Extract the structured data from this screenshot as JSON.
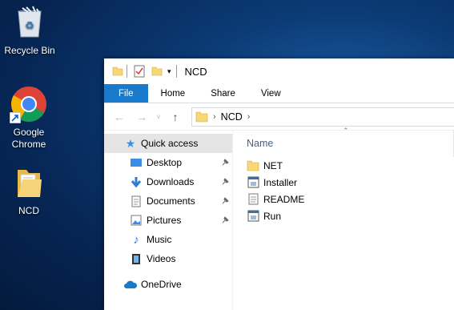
{
  "desktop": {
    "icons": [
      {
        "label": "Recycle Bin"
      },
      {
        "label": "Google Chrome"
      },
      {
        "label": "NCD"
      }
    ]
  },
  "window": {
    "title": "NCD",
    "ribbon_tabs": [
      "File",
      "Home",
      "Share",
      "View"
    ],
    "active_tab": "File",
    "address": {
      "path": [
        "NCD"
      ]
    },
    "nav": [
      {
        "label": "Quick access",
        "icon": "star-icon",
        "selected": true
      },
      {
        "label": "Desktop",
        "icon": "desktop-icon",
        "pinned": true
      },
      {
        "label": "Downloads",
        "icon": "download-arrow-icon",
        "pinned": true
      },
      {
        "label": "Documents",
        "icon": "document-icon",
        "pinned": true
      },
      {
        "label": "Pictures",
        "icon": "picture-icon",
        "pinned": true
      },
      {
        "label": "Music",
        "icon": "music-note-icon"
      },
      {
        "label": "Videos",
        "icon": "film-icon"
      },
      {
        "label": "OneDrive",
        "icon": "cloud-icon"
      }
    ],
    "column_header": "Name",
    "files": [
      {
        "name": "NET",
        "type": "folder"
      },
      {
        "name": "Installer",
        "type": "application"
      },
      {
        "name": "README",
        "type": "text"
      },
      {
        "name": "Run",
        "type": "application"
      }
    ]
  },
  "colors": {
    "accent": "#1979ca",
    "folder": "#f8d775",
    "selected_bg": "#e5e5e5"
  }
}
